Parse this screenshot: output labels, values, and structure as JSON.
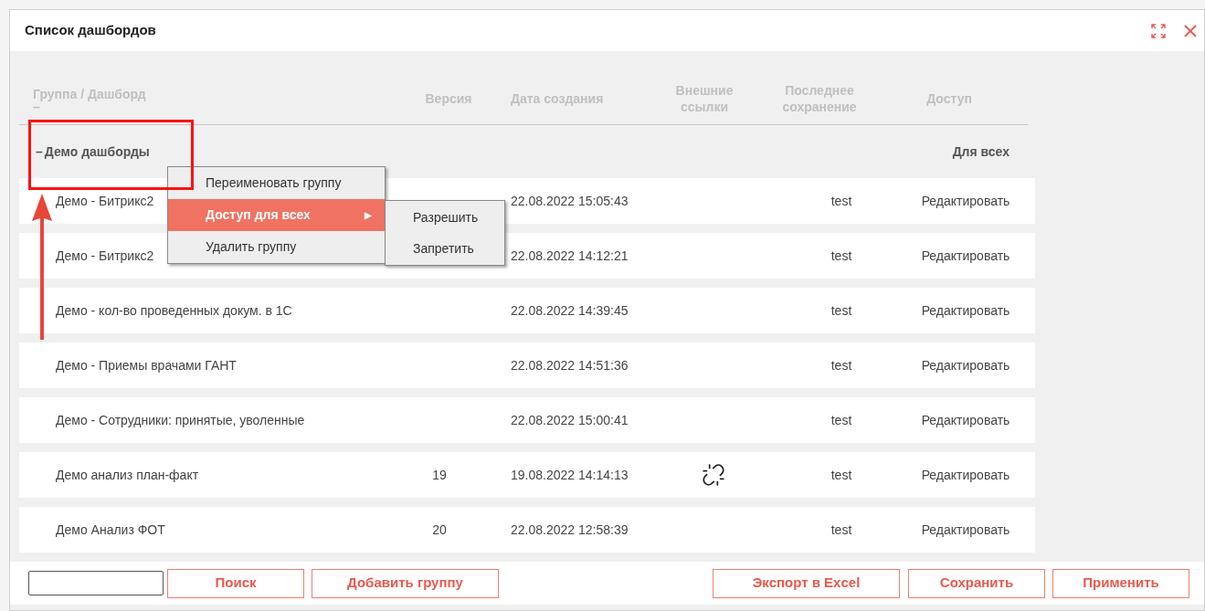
{
  "window": {
    "title": "Список дашбордов"
  },
  "table": {
    "columns": [
      "Группа / Дашборд",
      "Версия",
      "Дата создания",
      "Внешние ссылки",
      "Последнее сохранение",
      "Доступ"
    ],
    "collapse_mark": "–",
    "group": {
      "toggle": "–",
      "name": "Демо дашборды",
      "access": "Для всех",
      "expanded": true
    },
    "rows": [
      {
        "name": "Демо - Битрикс2",
        "version": "",
        "created": "22.08.2022 15:05:43",
        "external_link": false,
        "saved_by": "test",
        "access": "Редактировать"
      },
      {
        "name": "Демо - Битрикс2",
        "version": "",
        "created": "22.08.2022 14:12:21",
        "external_link": false,
        "saved_by": "test",
        "access": "Редактировать"
      },
      {
        "name": "Демо - кол-во проведенных докум. в 1С",
        "version": "",
        "created": "22.08.2022 14:39:45",
        "external_link": false,
        "saved_by": "test",
        "access": "Редактировать"
      },
      {
        "name": "Демо - Приемы врачами ГАНТ",
        "version": "",
        "created": "22.08.2022 14:51:36",
        "external_link": false,
        "saved_by": "test",
        "access": "Редактировать"
      },
      {
        "name": "Демо - Сотрудники: принятые, уволенные",
        "version": "",
        "created": "22.08.2022 15:00:41",
        "external_link": false,
        "saved_by": "test",
        "access": "Редактировать"
      },
      {
        "name": "Демо анализ план-факт",
        "version": "19",
        "created": "19.08.2022 14:14:13",
        "external_link": true,
        "saved_by": "test",
        "access": "Редактировать"
      },
      {
        "name": "Демо Анализ ФОТ",
        "version": "20",
        "created": "22.08.2022 12:58:39",
        "external_link": false,
        "saved_by": "test",
        "access": "Редактировать"
      }
    ]
  },
  "context_menu": {
    "items": [
      {
        "label": "Переименовать группу",
        "selected": false
      },
      {
        "label": "Доступ для всех",
        "selected": true,
        "arrow": "▶"
      },
      {
        "label": "Удалить группу",
        "selected": false
      }
    ],
    "submenu_items": [
      {
        "label": "Разрешить"
      },
      {
        "label": "Запретить"
      }
    ]
  },
  "footer": {
    "buttons": [
      "Поиск",
      "Добавить группу",
      "Экспорт в Excel",
      "Сохранить",
      "Применить"
    ]
  }
}
